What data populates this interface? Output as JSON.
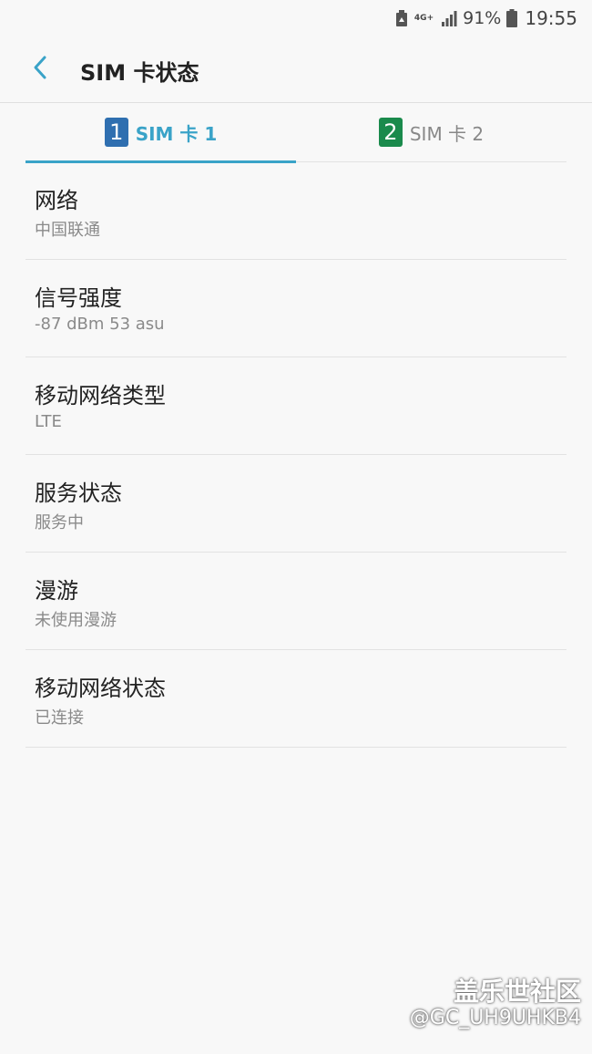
{
  "status_bar": {
    "network_type": "4G+",
    "battery_percent": "91%",
    "time": "19:55",
    "icons": [
      "recycle-notification-icon",
      "network-4g-icon",
      "signal-icon",
      "battery-icon"
    ]
  },
  "header": {
    "title": "SIM 卡状态"
  },
  "tabs": [
    {
      "number": "1",
      "label": "SIM 卡 1",
      "badge_color": "#2f6fb0",
      "selected": true
    },
    {
      "number": "2",
      "label": "SIM 卡 2",
      "badge_color": "#1a8a4c",
      "selected": false
    }
  ],
  "accent_color": "#3aa3c8",
  "items": [
    {
      "title": "网络",
      "value": "中国联通"
    },
    {
      "title": "信号强度",
      "value": "-87 dBm 53 asu"
    },
    {
      "title": "移动网络类型",
      "value": "LTE"
    },
    {
      "title": "服务状态",
      "value": "服务中"
    },
    {
      "title": "漫游",
      "value": "未使用漫游"
    },
    {
      "title": "移动网络状态",
      "value": "已连接"
    }
  ],
  "watermark": {
    "brand": "盖乐世社区",
    "user": "@GC_UH9UHKB4"
  }
}
